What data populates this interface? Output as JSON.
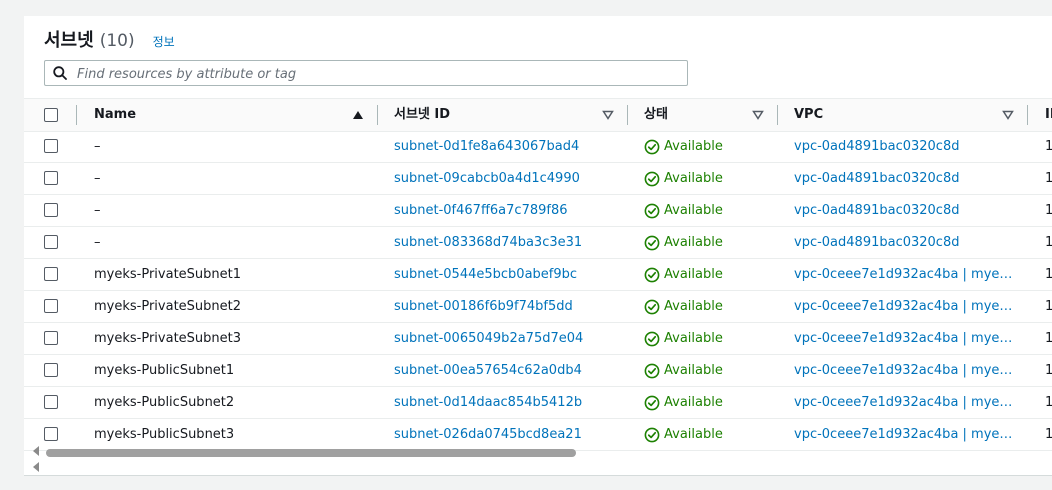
{
  "header": {
    "title": "서브넷",
    "count": "(10)",
    "info": "정보"
  },
  "search": {
    "placeholder": "Find resources by attribute or tag"
  },
  "columns": {
    "name": "Name",
    "subnet_id": "서브넷 ID",
    "state": "상태",
    "vpc": "VPC",
    "ip": "IP"
  },
  "rows": [
    {
      "name": "–",
      "subnet_id": "subnet-0d1fe8a643067bad4",
      "state": "Available",
      "vpc": "vpc-0ad4891bac0320c8d",
      "ip": "1"
    },
    {
      "name": "–",
      "subnet_id": "subnet-09cabcb0a4d1c4990",
      "state": "Available",
      "vpc": "vpc-0ad4891bac0320c8d",
      "ip": "1"
    },
    {
      "name": "–",
      "subnet_id": "subnet-0f467ff6a7c789f86",
      "state": "Available",
      "vpc": "vpc-0ad4891bac0320c8d",
      "ip": "1"
    },
    {
      "name": "–",
      "subnet_id": "subnet-083368d74ba3c3e31",
      "state": "Available",
      "vpc": "vpc-0ad4891bac0320c8d",
      "ip": "1"
    },
    {
      "name": "myeks-PrivateSubnet1",
      "subnet_id": "subnet-0544e5bcb0abef9bc",
      "state": "Available",
      "vpc": "vpc-0ceee7e1d932ac4ba | myek...",
      "ip": "1"
    },
    {
      "name": "myeks-PrivateSubnet2",
      "subnet_id": "subnet-00186f6b9f74bf5dd",
      "state": "Available",
      "vpc": "vpc-0ceee7e1d932ac4ba | myek...",
      "ip": "1"
    },
    {
      "name": "myeks-PrivateSubnet3",
      "subnet_id": "subnet-0065049b2a75d7e04",
      "state": "Available",
      "vpc": "vpc-0ceee7e1d932ac4ba | myek...",
      "ip": "1"
    },
    {
      "name": "myeks-PublicSubnet1",
      "subnet_id": "subnet-00ea57654c62a0db4",
      "state": "Available",
      "vpc": "vpc-0ceee7e1d932ac4ba | myek...",
      "ip": "1"
    },
    {
      "name": "myeks-PublicSubnet2",
      "subnet_id": "subnet-0d14daac854b5412b",
      "state": "Available",
      "vpc": "vpc-0ceee7e1d932ac4ba | myek...",
      "ip": "1"
    },
    {
      "name": "myeks-PublicSubnet3",
      "subnet_id": "subnet-026da0745bcd8ea21",
      "state": "Available",
      "vpc": "vpc-0ceee7e1d932ac4ba | myek...",
      "ip": "1"
    }
  ],
  "icons": {
    "search": "search-icon",
    "sort_asc": "sort-ascending-icon",
    "sort_down": "sort-descending-icon",
    "status": "check-circle-icon",
    "scroll_left": "caret-left-icon"
  },
  "colors": {
    "link": "#0073bb",
    "available": "#1d8102",
    "background": "#f2f3f3"
  }
}
